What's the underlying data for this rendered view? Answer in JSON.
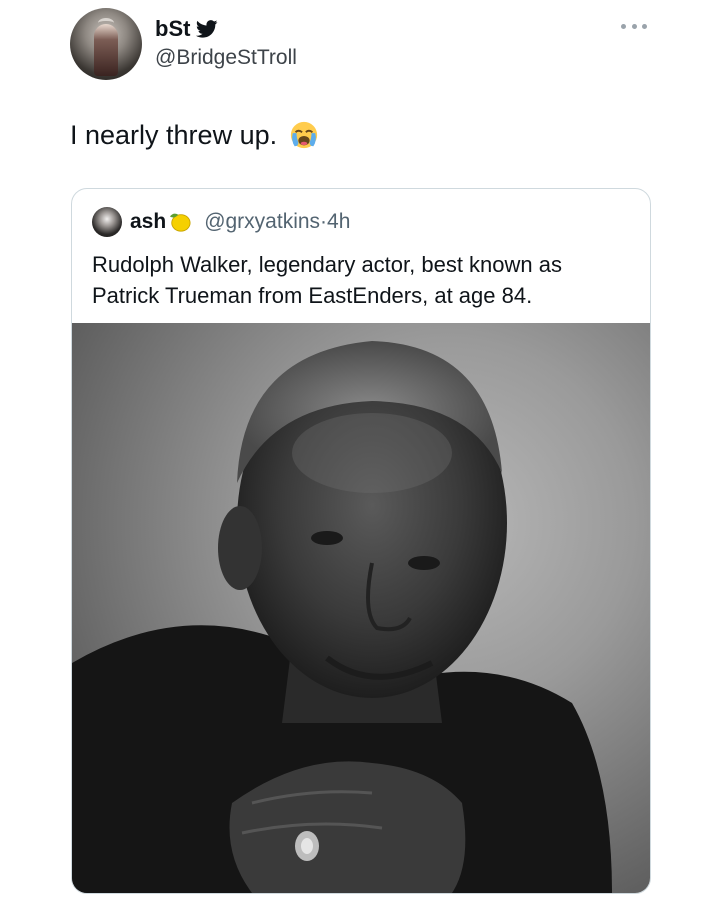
{
  "tweet": {
    "author": {
      "display_name": "bSt",
      "handle": "@BridgeStTroll",
      "verified_icon": "bird-icon"
    },
    "menu_icon": "more-dots-icon",
    "text": "I nearly threw up.",
    "emoji": "loudly-crying-face-emoji"
  },
  "quoted_tweet": {
    "author": {
      "display_name": "ash",
      "name_emoji": "lemon-icon",
      "handle": "@grxyatkins",
      "time": "·4h"
    },
    "text": "Rudolph Walker, legendary actor, best known as Patrick Trueman from EastEnders, at age 84.",
    "media": "black-and-white-portrait-photo"
  },
  "colors": {
    "text": "#0f1419",
    "secondary_text": "#536471",
    "border": "#cfd9de",
    "twitter_blue": "#0f1419"
  }
}
